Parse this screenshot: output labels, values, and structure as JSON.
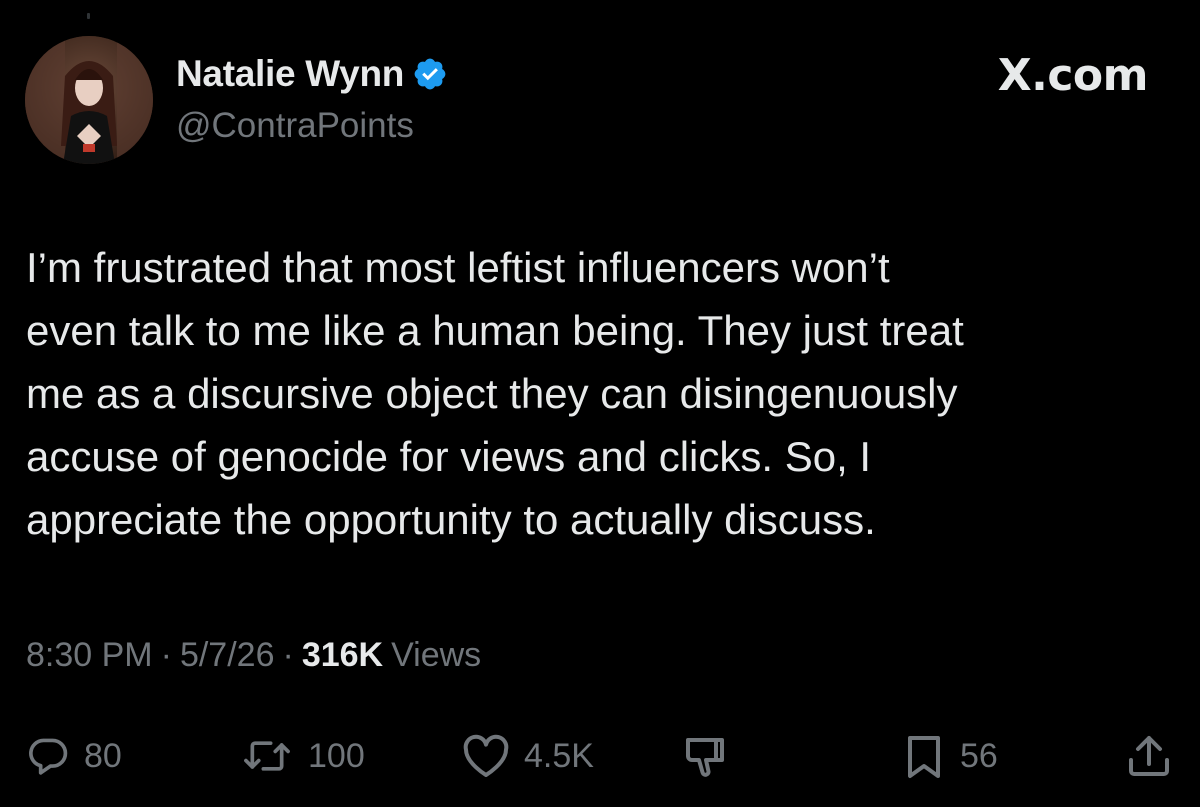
{
  "header": {
    "display_name": "Natalie Wynn",
    "handle": "@ContraPoints",
    "verified": true,
    "brand": "X.com"
  },
  "tweet": {
    "lines": [
      "I’m frustrated that most leftist influencers won’t",
      "even talk to me like a human being. They just treat",
      "me as a discursive object they can disingenuously",
      "accuse of genocide for views and clicks. So, I",
      "appreciate the opportunity to actually discuss."
    ]
  },
  "meta": {
    "time": "8:30 PM",
    "date": "5/7/26",
    "separator": "·",
    "views_count": "316K",
    "views_label": "Views"
  },
  "actions": {
    "replies": "80",
    "reposts": "100",
    "likes": "4.5K",
    "bookmarks": "56"
  },
  "colors": {
    "background": "#000000",
    "primary_text": "#e7e9ea",
    "secondary_text": "#71767b",
    "verified_badge": "#1d9bf0"
  },
  "icons": {
    "reply": "reply-icon",
    "repost": "repost-icon",
    "like": "heart-icon",
    "dislike": "dislike-icon",
    "bookmark": "bookmark-icon",
    "share": "share-icon",
    "verified": "verified-badge-icon"
  }
}
